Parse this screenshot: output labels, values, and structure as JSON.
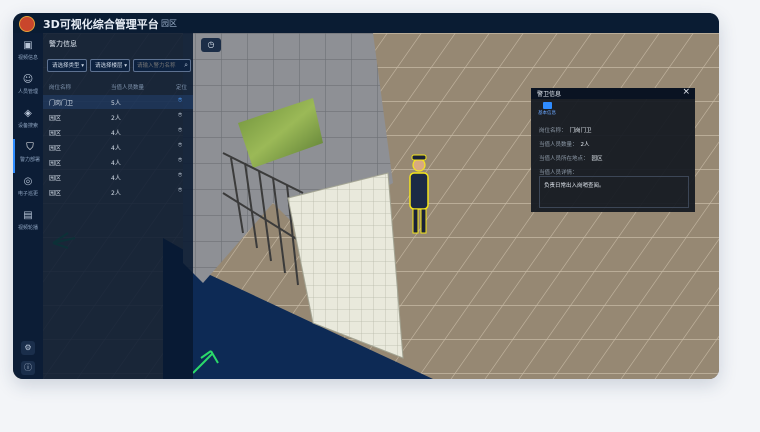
{
  "app": {
    "title": "3D可视化综合管理平台",
    "breadcrumb": "园区"
  },
  "sidebar": {
    "items": [
      {
        "label": "视频信息",
        "icon": "video-icon"
      },
      {
        "label": "人员管理",
        "icon": "person-icon"
      },
      {
        "label": "设备搜索",
        "icon": "device-icon"
      },
      {
        "label": "警力部署",
        "icon": "shield-icon"
      },
      {
        "label": "电子巡更",
        "icon": "location-icon"
      },
      {
        "label": "视频轮播",
        "icon": "carousel-icon"
      }
    ],
    "active_index": 3
  },
  "panel": {
    "title": "警力信息",
    "select_type": "请选择类型",
    "select_building": "请选择楼层",
    "search_placeholder": "请输入警力名称",
    "columns": [
      "岗位名称",
      "当值人员数量",
      "定位"
    ],
    "rows": [
      {
        "name": "门岗门卫",
        "count": "5人"
      },
      {
        "name": "园区",
        "count": "2人"
      },
      {
        "name": "园区",
        "count": "4人"
      },
      {
        "name": "园区",
        "count": "4人"
      },
      {
        "name": "园区",
        "count": "4人"
      },
      {
        "name": "园区",
        "count": "4人"
      },
      {
        "name": "园区",
        "count": "2人"
      }
    ],
    "selected_row": 0
  },
  "popup": {
    "title": "警卫信息",
    "tab_label": "基本信息",
    "fields": [
      {
        "key": "岗位名称：",
        "value": "门岗门卫"
      },
      {
        "key": "当值人员数量：",
        "value": "2人"
      },
      {
        "key": "当值人员所在地点：",
        "value": "园区"
      },
      {
        "key": "当值人员详情：",
        "value": ""
      }
    ],
    "detail": "负责日常出入岗哨查阅。"
  },
  "colors": {
    "accent": "#2f8cff",
    "topbar": "#0a1c33",
    "panel": "#081830"
  }
}
